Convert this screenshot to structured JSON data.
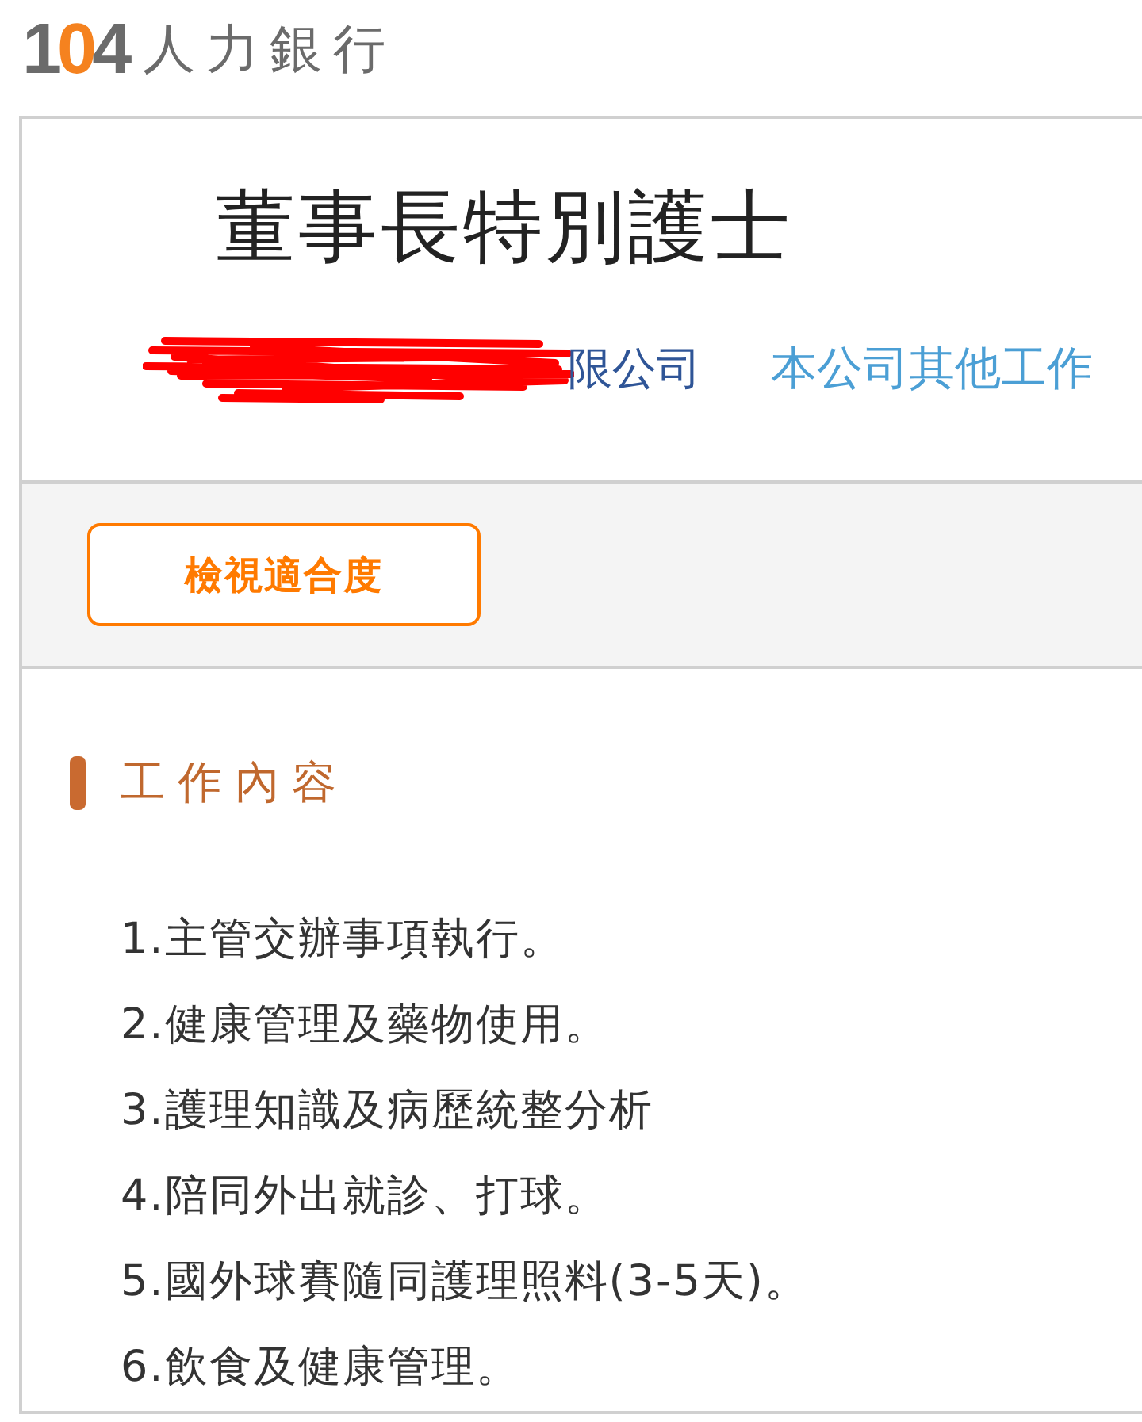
{
  "logo": {
    "number": "104",
    "name": "人力銀行"
  },
  "job": {
    "title": "董事長特別護士",
    "company": "限公司",
    "other_jobs_link": "本公司其他工作"
  },
  "fit_button": {
    "label": "檢視適合度"
  },
  "section": {
    "heading": "工作內容",
    "items": [
      "1.主管交辦事項執行。",
      "2.健康管理及藥物使用。",
      "3.護理知識及病歷統整分析",
      "4.陪同外出就診、打球。",
      "5.國外球賽隨同護理照料(3-5天)。",
      "6.飲食及健康管理。"
    ]
  }
}
